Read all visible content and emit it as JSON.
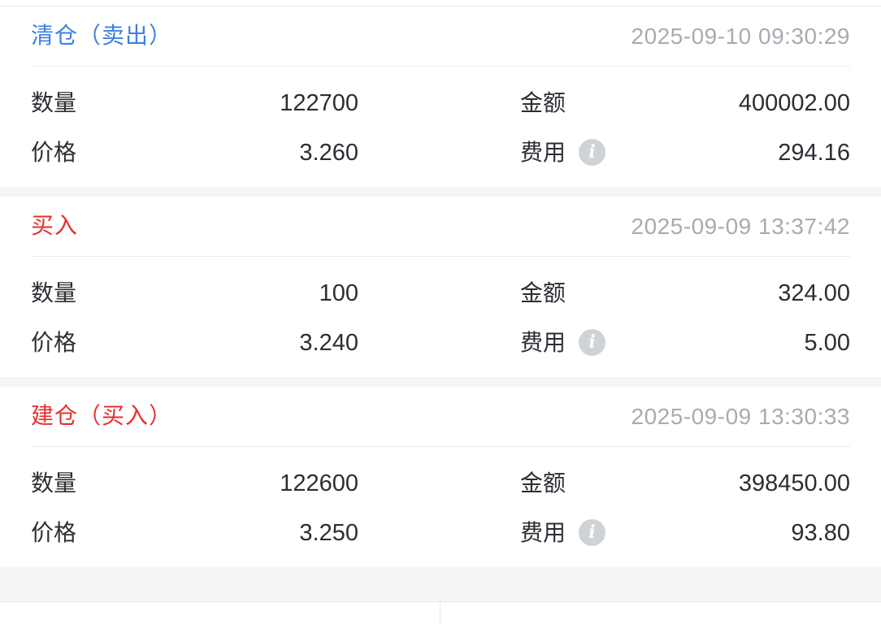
{
  "colors": {
    "sell": "#3d7fe0",
    "buy": "#e6302e",
    "time": "#a8abb1",
    "text": "#2b2e33",
    "background": "#f4f5f7"
  },
  "trades": [
    {
      "type": "清仓（卖出）",
      "color": "#3d7fe0",
      "time": "2025-09-10 09:30:29",
      "quantity_label": "数量",
      "quantity": "122700",
      "amount_label": "金额",
      "amount": "400002.00",
      "price_label": "价格",
      "price": "3.260",
      "fee_label": "费用",
      "fee_icon": "info-icon",
      "fee": "294.16"
    },
    {
      "type": "买入",
      "color": "#e6302e",
      "time": "2025-09-09 13:37:42",
      "quantity_label": "数量",
      "quantity": "100",
      "amount_label": "金额",
      "amount": "324.00",
      "price_label": "价格",
      "price": "3.240",
      "fee_label": "费用",
      "fee_icon": "info-icon",
      "fee": "5.00"
    },
    {
      "type": "建仓（买入）",
      "color": "#e6302e",
      "time": "2025-09-09 13:30:33",
      "quantity_label": "数量",
      "quantity": "122600",
      "amount_label": "金额",
      "amount": "398450.00",
      "price_label": "价格",
      "price": "3.250",
      "fee_label": "费用",
      "fee_icon": "info-icon",
      "fee": "93.80"
    }
  ]
}
